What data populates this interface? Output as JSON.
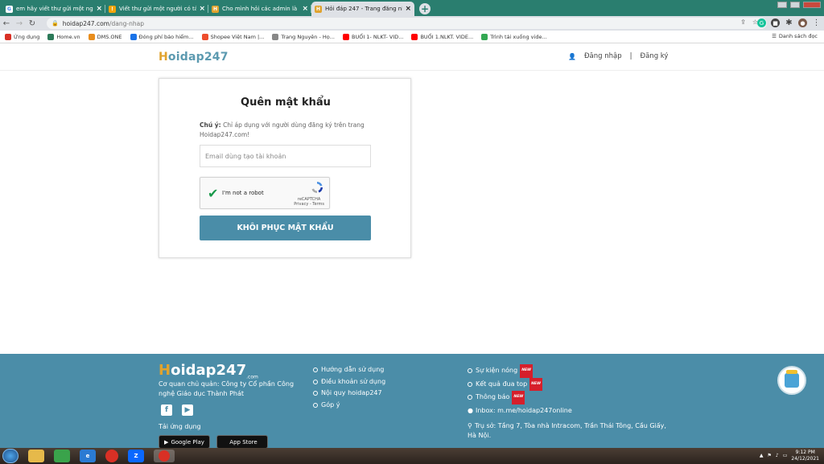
{
  "browser": {
    "tabs": [
      {
        "title": "em hãy viết thư gửi một người c...",
        "favicon": "G",
        "color": "#ffffff",
        "active": false
      },
      {
        "title": "Viết thư gửi một người có tấm ả...",
        "favicon": "!",
        "color": "#f2a40a",
        "active": false
      },
      {
        "title": "Cho mình hỏi các admin là làm t...",
        "favicon": "H",
        "color": "#e0a32e",
        "active": false
      },
      {
        "title": "Hỏi đáp 247 - Trang đăng nhập",
        "favicon": "H",
        "color": "#e0a32e",
        "active": true
      }
    ],
    "url_host": "hoidap247.com",
    "url_path": "/dang-nhap",
    "bookmarks": [
      {
        "label": "Ứng dụng",
        "color": "#d93025"
      },
      {
        "label": "Home.vn",
        "color": "#2c7a59"
      },
      {
        "label": "DMS.ONE",
        "color": "#e88d1d"
      },
      {
        "label": "Đóng phí bảo hiểm...",
        "color": "#1a73e8"
      },
      {
        "label": "Shopee Việt Nam |...",
        "color": "#ee4d2d"
      },
      {
        "label": "Trạng Nguyên - Họ...",
        "color": "#888888"
      },
      {
        "label": "BUỔI 1- NLKT- VID...",
        "color": "#ff0000"
      },
      {
        "label": "BUỔI 1.NLKT. VIDE...",
        "color": "#ff0000"
      },
      {
        "label": "Trình tải xuống vide...",
        "color": "#34a853"
      }
    ],
    "reading_list": "Danh sách đọc"
  },
  "header": {
    "logo_h": "H",
    "logo_rest": "oidap247",
    "login": "Đăng nhập",
    "separator": "|",
    "register": "Đăng ký"
  },
  "form": {
    "title": "Quên mật khẩu",
    "note_label": "Chú ý:",
    "note_text": " Chỉ áp dụng với người dùng đăng ký trên trang Hoidap247.com!",
    "email_placeholder": "Email dùng tạo tài khoản",
    "recaptcha_label": "I'm not a robot",
    "recaptcha_brand": "reCAPTCHA",
    "recaptcha_links": "Privacy - Terms",
    "submit": "KHÔI PHỤC MẬT KHẨU"
  },
  "footer": {
    "logo_h": "H",
    "logo_rest": "oidap247",
    "logo_suffix": ".com",
    "description": "Cơ quan chủ quản: Công ty Cổ phần Công nghệ Giáo dục Thành Phát",
    "download_label": "Tải ứng dụng",
    "google_play": "Google Play",
    "app_store": "App Store",
    "links_col1": [
      "Hướng dẫn sử dụng",
      "Điều khoản sử dụng",
      "Nội quy hoidap247",
      "Góp ý"
    ],
    "links_col2": [
      "Sự kiện nóng",
      "Kết quả đua top",
      "Thông báo"
    ],
    "new_badge": "NEW",
    "inbox": "Inbox: m.me/hoidap247online",
    "address": "Trụ sở: Tầng 7, Tòa nhà Intracom, Trần Thái Tông, Cầu Giấy, Hà Nội."
  },
  "taskbar": {
    "time": "9:12 PM",
    "date": "24/12/2021"
  }
}
